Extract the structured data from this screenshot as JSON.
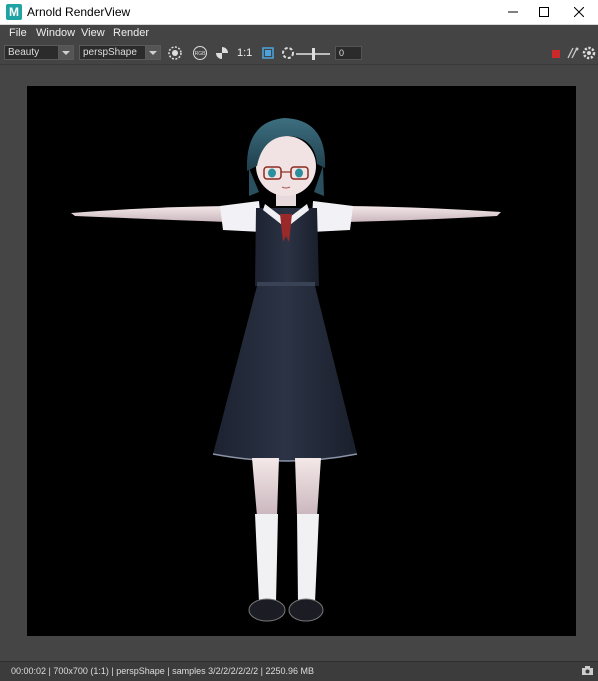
{
  "window": {
    "title": "Arnold RenderView",
    "app_icon_letter": "M",
    "controls": [
      "minimize-icon",
      "maximize-icon",
      "close-icon"
    ]
  },
  "menu": {
    "items": [
      "File",
      "Window",
      "View",
      "Render"
    ]
  },
  "toolbar": {
    "aov_dropdown": "Beauty",
    "camera_dropdown": "perspShape",
    "ratio_label": "1:1",
    "exposure_value": "0",
    "icons": [
      "refresh-render-icon",
      "rgb-channel-icon",
      "checker-icon",
      "crop-region-icon",
      "exposure-icon",
      "stop-render-icon",
      "ipr-icon",
      "settings-icon"
    ],
    "stop_color": "#cc2a2a"
  },
  "render": {
    "description": "render of anime girl character in T-pose on black background",
    "background": "#000000"
  },
  "status": {
    "text": "00:00:02 | 700x700 (1:1) | perspShape  | samples 3/2/2/2/2/2/2 | 2250.96 MB"
  }
}
